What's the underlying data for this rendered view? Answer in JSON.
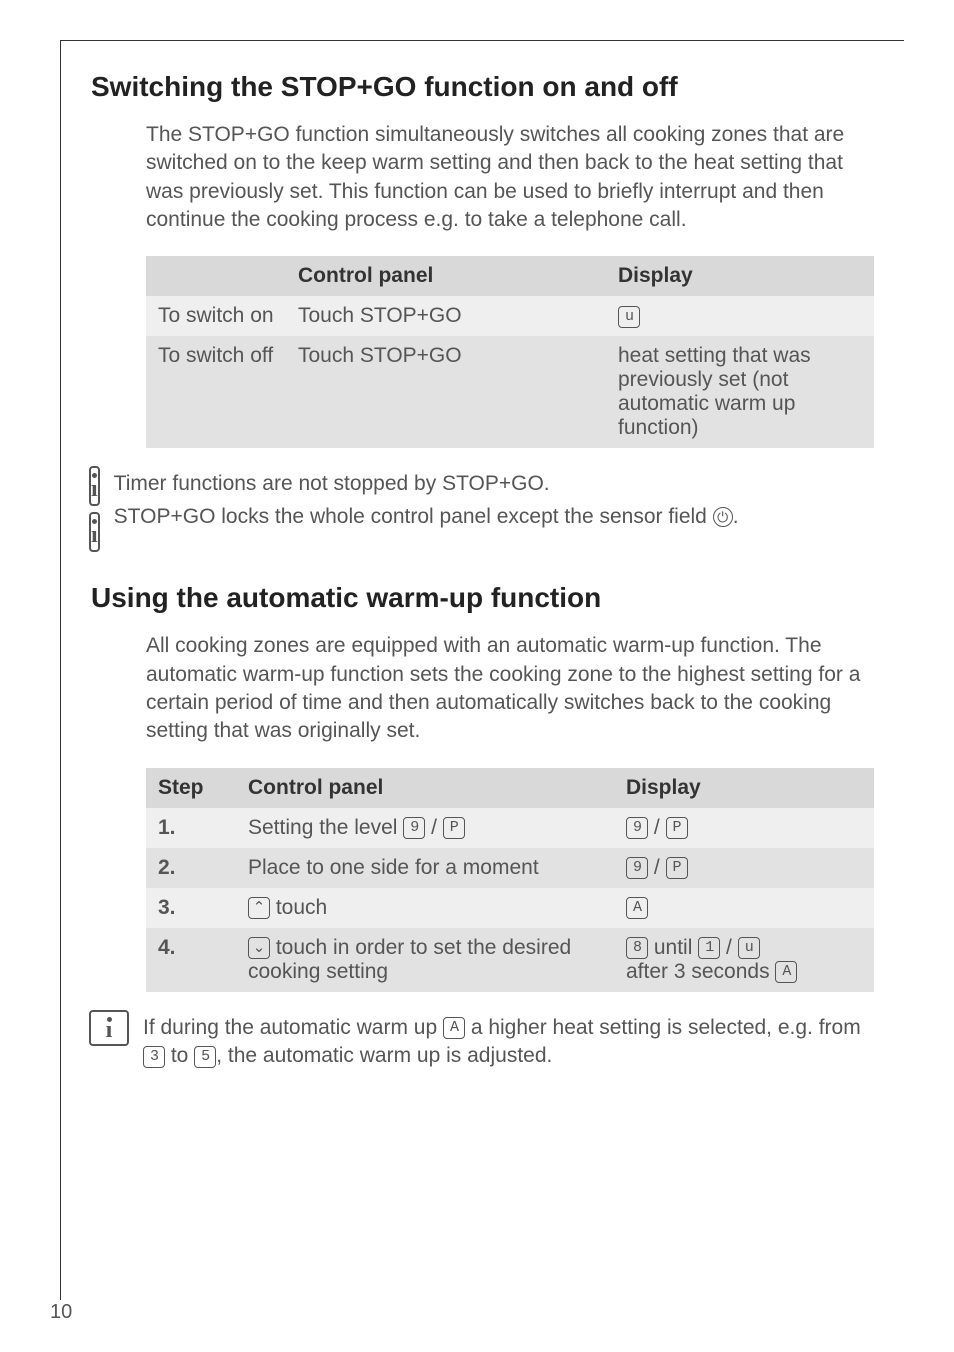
{
  "page_number": "10",
  "section1": {
    "heading": "Switching the STOP+GO function on and off",
    "intro": "The STOP+GO function simultaneously switches all cooking zones that are switched on to the keep warm setting and then back to the heat setting that was previously set. This function can be used to briefly interrupt and then continue the cooking process e.g. to take a telephone call.",
    "table": {
      "headers": [
        "",
        "Control panel",
        "Display"
      ],
      "rows": [
        {
          "c1": "To switch on",
          "c2": "Touch STOP+GO",
          "c3_icon": "u"
        },
        {
          "c1": "To switch off",
          "c2": "Touch STOP+GO",
          "c3_text": "heat setting that was previously set (not automatic warm up function)"
        }
      ]
    },
    "info1": "Timer functions are not stopped by STOP+GO.",
    "info2_pre": "STOP+GO locks the whole control panel except the sensor field ",
    "info2_icon": "⏻",
    "info2_post": "."
  },
  "section2": {
    "heading": "Using the automatic warm-up function",
    "intro": "All cooking zones are equipped with an automatic warm-up function. The automatic warm-up function sets the cooking zone to the highest setting for a certain period of time and then automatically switches back to the cooking setting that was originally set.",
    "table": {
      "headers": [
        "Step",
        "Control panel",
        "Display"
      ],
      "rows": [
        {
          "step": "1.",
          "cp_pre": "Setting the level ",
          "cp_icons": [
            "9",
            "P"
          ],
          "cp_sep": " / ",
          "disp_icons": [
            "9",
            "P"
          ],
          "disp_sep": " / "
        },
        {
          "step": "2.",
          "cp_text": "Place to one side for a moment",
          "disp_icons": [
            "9",
            "P"
          ],
          "disp_sep": " / "
        },
        {
          "step": "3.",
          "cp_icon": "⌃",
          "cp_post": " touch",
          "disp_icons": [
            "A"
          ]
        },
        {
          "step": "4.",
          "cp_icon": "⌄",
          "cp_post": " touch in order to set the desired cooking setting",
          "disp_line1_icons": [
            "8",
            "1",
            "u"
          ],
          "disp_line1_tpl": "{0} until {1} / {2}",
          "disp_line2_pre": "after 3 seconds ",
          "disp_line2_icon": "A"
        }
      ]
    },
    "info_pre": "If during the automatic warm up ",
    "info_icon1": "A",
    "info_mid1": " a higher heat setting is selected, e.g. from ",
    "info_icon2": "3",
    "info_mid2": " to ",
    "info_icon3": "5",
    "info_post": ", the automatic warm up is adjusted."
  }
}
